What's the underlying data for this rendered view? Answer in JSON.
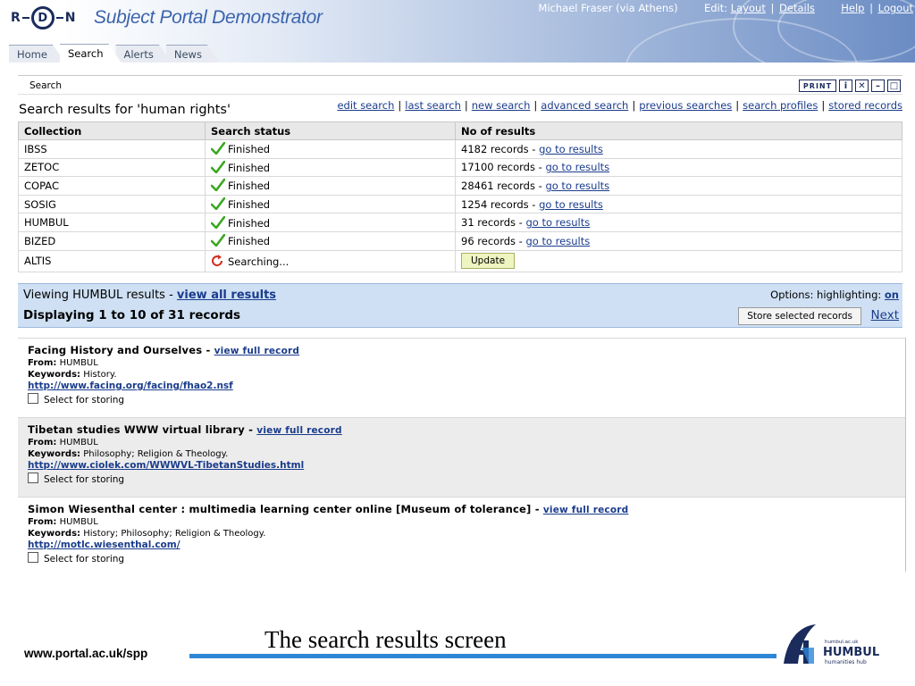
{
  "header": {
    "logo_letters": [
      "R",
      "D",
      "N"
    ],
    "title": "Subject Portal Demonstrator",
    "user": "Michael Fraser (via Athens)",
    "edit_label": "Edit:",
    "layout_link": "Layout",
    "details_link": "Details",
    "help_link": "Help",
    "logout_link": "Logout",
    "separator": "|"
  },
  "tabs": [
    {
      "label": "Home",
      "active": false
    },
    {
      "label": "Search",
      "active": true
    },
    {
      "label": "Alerts",
      "active": false
    },
    {
      "label": "News",
      "active": false
    }
  ],
  "panel": {
    "breadcrumb": "Search",
    "print_label": "PRINT",
    "info_glyph": "i",
    "close_glyph": "✕",
    "min_glyph": "–",
    "max_glyph": "□",
    "results_title": "Search results for 'human rights'",
    "links": [
      "edit search",
      "last search",
      "new search",
      "advanced search",
      "previous searches",
      "search profiles",
      "stored records"
    ]
  },
  "table": {
    "headers": [
      "Collection",
      "Search status",
      "No of results"
    ],
    "rows": [
      {
        "collection": "IBSS",
        "status": "Finished",
        "count": "4182 records -",
        "link": "go to results"
      },
      {
        "collection": "ZETOC",
        "status": "Finished",
        "count": "17100 records -",
        "link": "go to results"
      },
      {
        "collection": "COPAC",
        "status": "Finished",
        "count": "28461 records -",
        "link": "go to results"
      },
      {
        "collection": "SOSIG",
        "status": "Finished",
        "count": "1254 records -",
        "link": "go to results"
      },
      {
        "collection": "HUMBUL",
        "status": "Finished",
        "count": "31 records -",
        "link": "go to results"
      },
      {
        "collection": "BIZED",
        "status": "Finished",
        "count": "96 records -",
        "link": "go to results"
      }
    ],
    "pending_row": {
      "collection": "ALTIS",
      "status": "Searching...",
      "button": "Update"
    }
  },
  "viewing": {
    "prefix": "Viewing HUMBUL results -",
    "view_all": "view all results",
    "options_label": "Options: highlighting:",
    "options_value": "on",
    "displaying": "Displaying 1 to 10 of 31 records",
    "store_button": "Store selected records",
    "next": "Next"
  },
  "records": [
    {
      "title": "Facing History and Ourselves",
      "view_link": "view full record",
      "from_label": "From:",
      "from": "HUMBUL",
      "keywords_label": "Keywords:",
      "keywords": "History.",
      "url": "http://www.facing.org/facing/fhao2.nsf",
      "select_label": "Select for storing"
    },
    {
      "title": "Tibetan studies WWW virtual library",
      "view_link": "view full record",
      "from_label": "From:",
      "from": "HUMBUL",
      "keywords_label": "Keywords:",
      "keywords": "Philosophy; Religion & Theology.",
      "url": "http://www.ciolek.com/WWWVL-TibetanStudies.html",
      "select_label": "Select for storing"
    },
    {
      "title": "Simon Wiesenthal center : multimedia learning center online [Museum of tolerance]",
      "view_link": "view full record",
      "from_label": "From:",
      "from": "HUMBUL",
      "keywords_label": "Keywords:",
      "keywords": "History; Philosophy; Religion & Theology.",
      "url": "http://motlc.wiesenthal.com/",
      "select_label": "Select for storing"
    }
  ],
  "footer": {
    "url": "www.portal.ac.uk/spp",
    "caption": "The search results screen",
    "logo_small": "humbul.ac.uk",
    "logo_name": "HUMBUL",
    "logo_sub": "humanities hub"
  },
  "colors": {
    "accent": "#3b63ad",
    "link": "#1a3c8c",
    "viewing_bg": "#cfe0f4",
    "footer_line": "#2e86d6",
    "tick_green": "#3aa820",
    "searching_red": "#d03020"
  }
}
